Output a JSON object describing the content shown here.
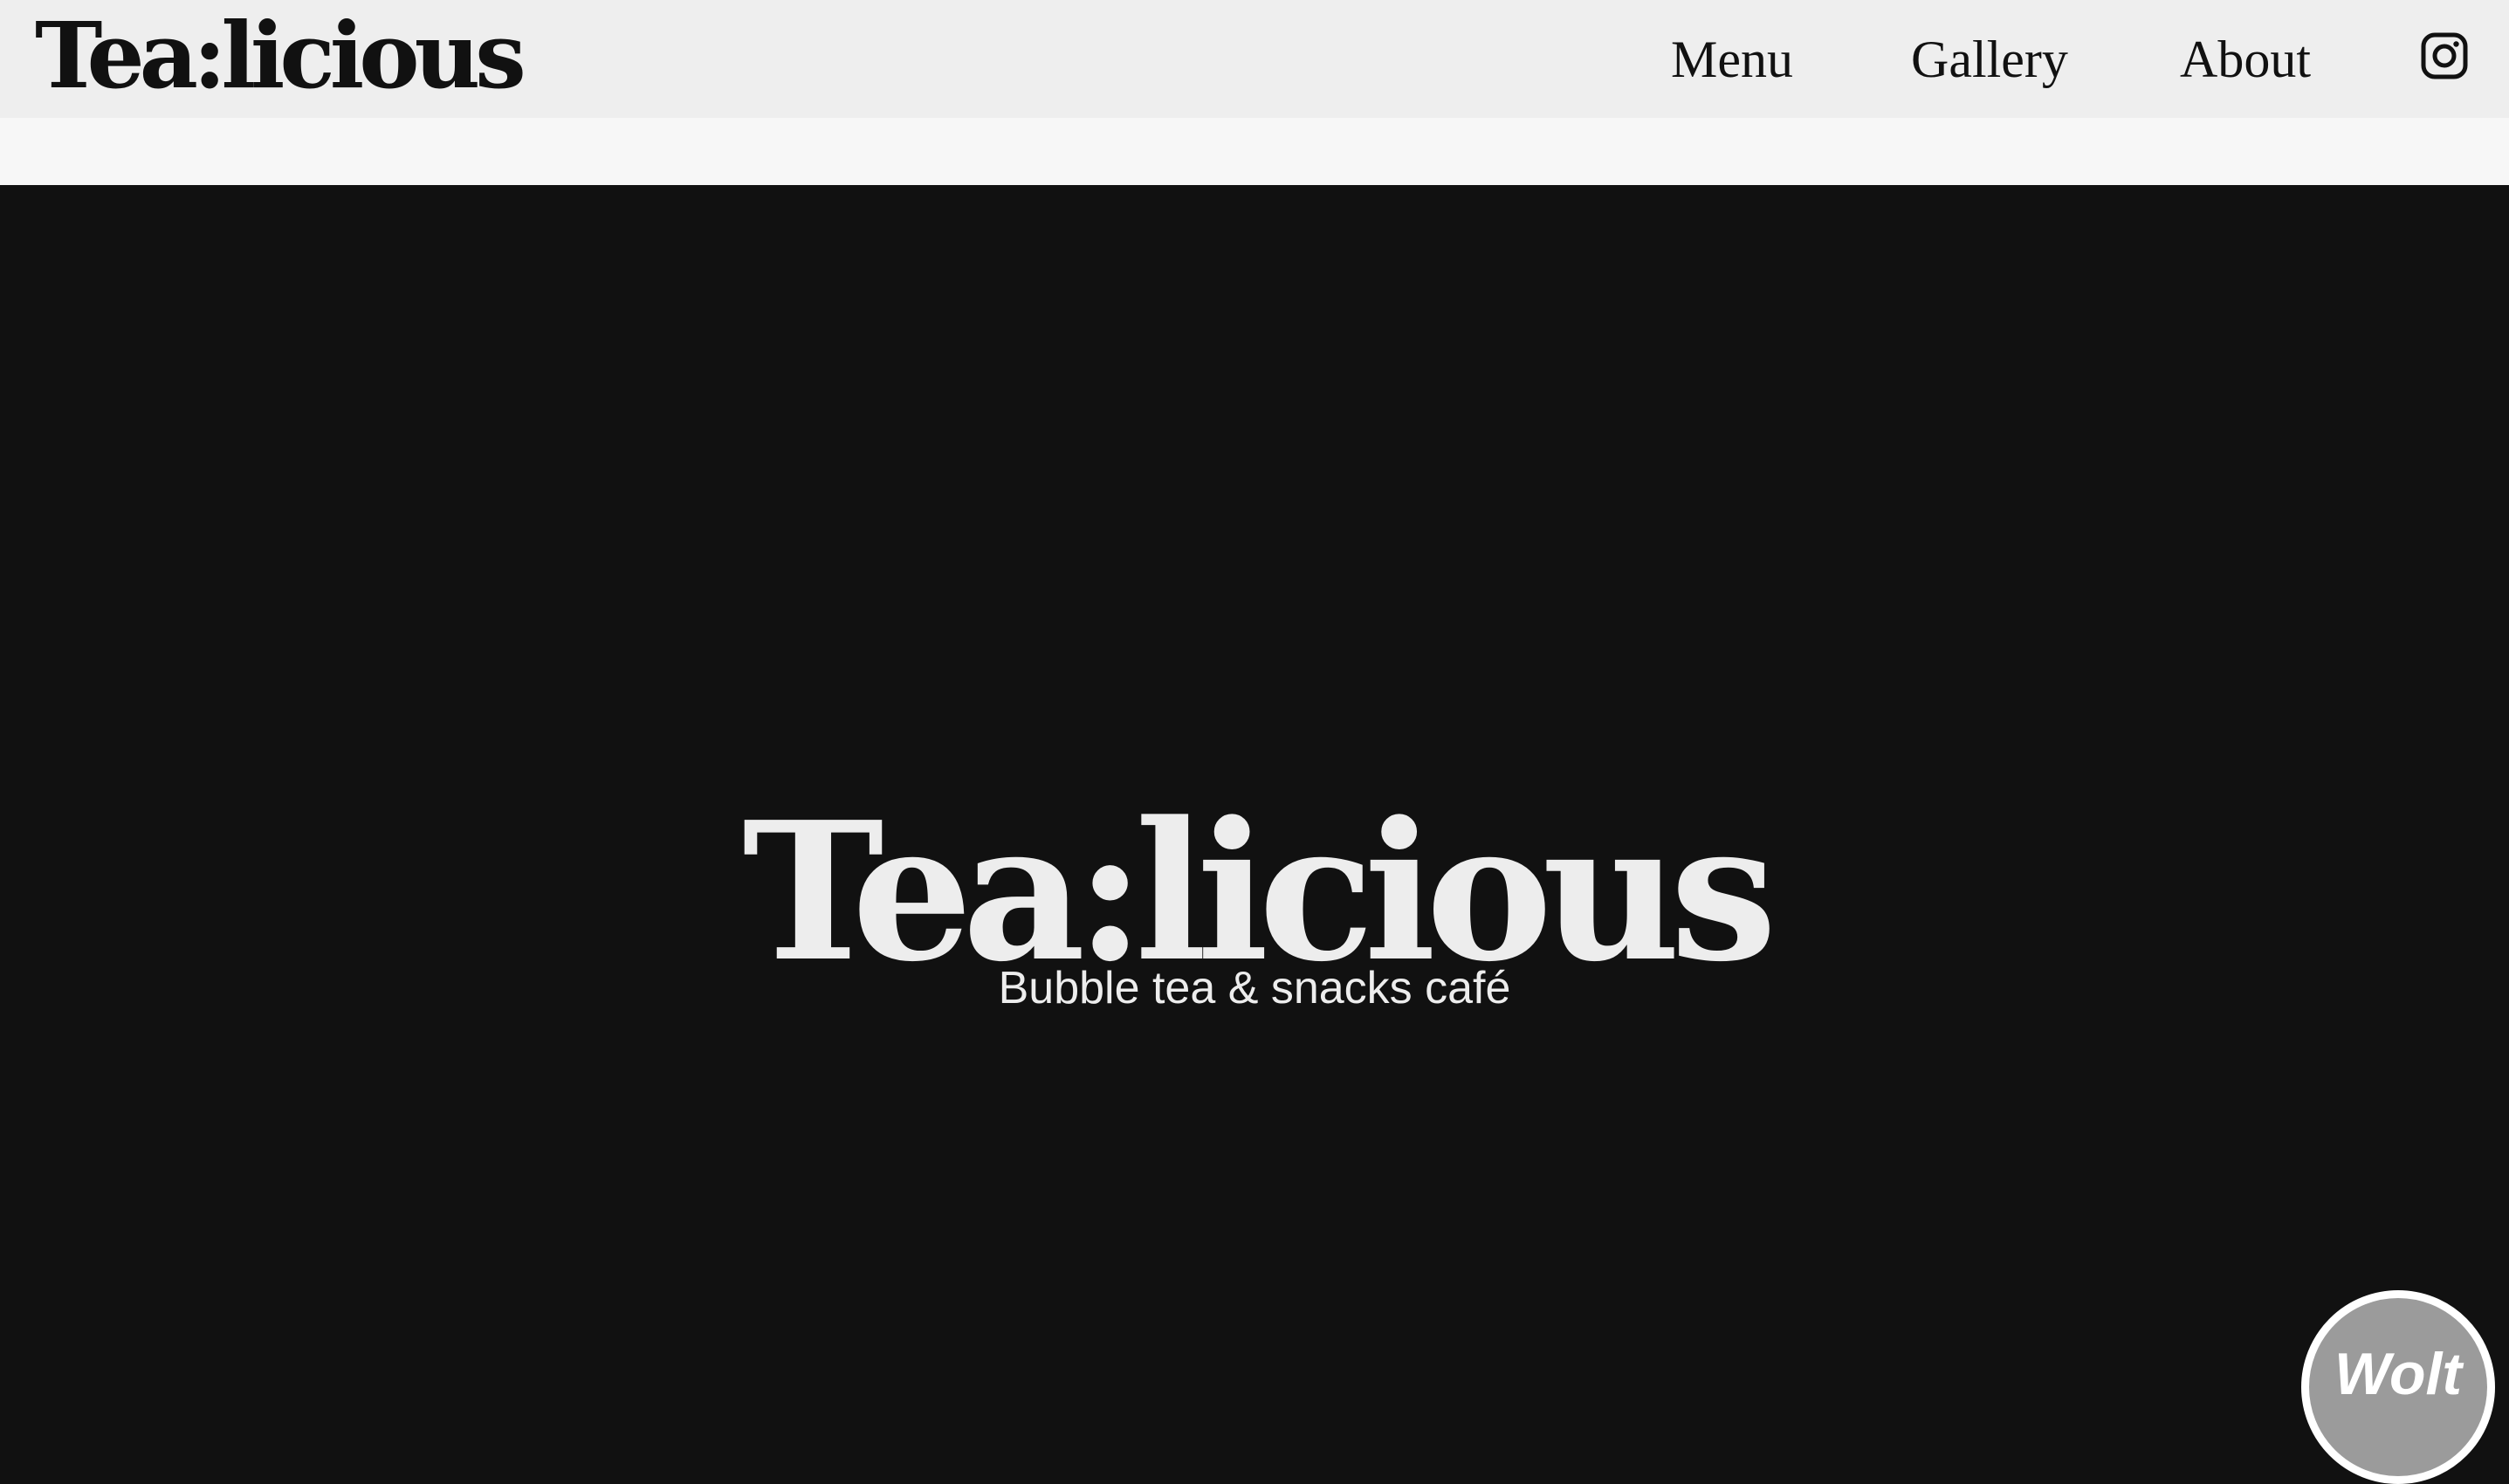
{
  "header": {
    "logo": "Tea:licious",
    "nav": {
      "menu": "Menu",
      "gallery": "Gallery",
      "about": "About"
    },
    "instagram_icon": "instagram-icon"
  },
  "hero": {
    "title": "Tea:licious",
    "subtitle": "Bubble tea & snacks café"
  },
  "wolt_button": {
    "label": "Wolt"
  },
  "colors": {
    "header_bg": "#eeeeee",
    "band_bg": "#f7f7f7",
    "hero_bg": "#111111",
    "hero_text": "#ededed",
    "wolt_bg": "#9b9b9b"
  }
}
